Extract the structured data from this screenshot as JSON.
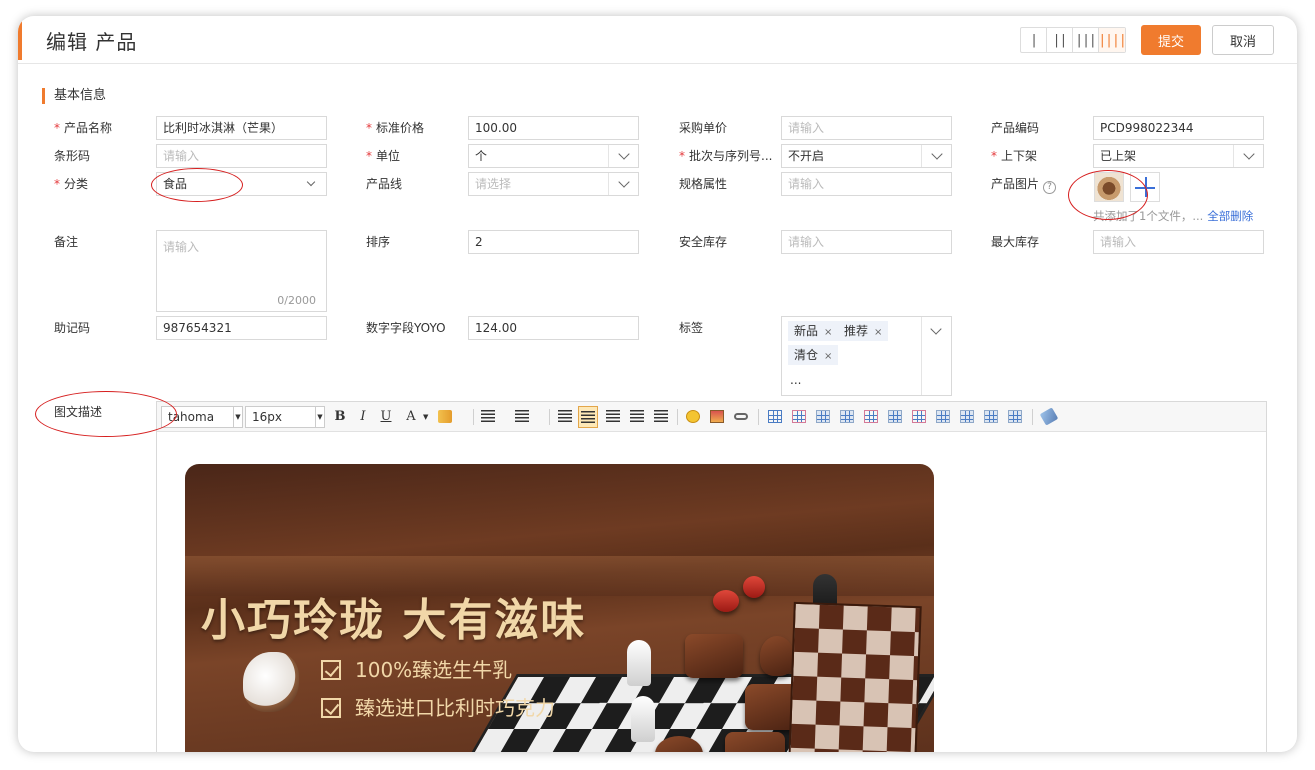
{
  "header": {
    "title": "编辑 产品",
    "layouts": [
      "|",
      "||",
      "|||",
      "||||"
    ],
    "submit_label": "提交",
    "cancel_label": "取消"
  },
  "section": {
    "title": "基本信息"
  },
  "fields": {
    "product_name": {
      "label": "产品名称",
      "value": "比利时冰淇淋（芒果）"
    },
    "std_price": {
      "label": "标准价格",
      "value": "100.00"
    },
    "purchase_price": {
      "label": "采购单价",
      "placeholder": "请输入"
    },
    "product_code": {
      "label": "产品编码",
      "value": "PCD998022344"
    },
    "barcode": {
      "label": "条形码",
      "placeholder": "请输入"
    },
    "unit": {
      "label": "单位",
      "value": "个"
    },
    "batch": {
      "label": "批次与序列号...",
      "value": "不开启"
    },
    "shelf": {
      "label": "上下架",
      "value": "已上架"
    },
    "category": {
      "label": "分类",
      "value": "食品"
    },
    "product_line": {
      "label": "产品线",
      "placeholder": "请选择"
    },
    "spec": {
      "label": "规格属性",
      "placeholder": "请输入"
    },
    "image": {
      "label": "产品图片",
      "help": "?",
      "note": "共添加了1个文件，...",
      "delete_all": "全部删除"
    },
    "remark": {
      "label": "备注",
      "placeholder": "请输入",
      "counter": "0/2000"
    },
    "sort": {
      "label": "排序",
      "value": "2"
    },
    "safety_stock": {
      "label": "安全库存",
      "placeholder": "请输入"
    },
    "max_stock": {
      "label": "最大库存",
      "placeholder": "请输入"
    },
    "mnemonic": {
      "label": "助记码",
      "value": "987654321"
    },
    "number_field": {
      "label": "数字字段YOYO",
      "value": "124.00"
    },
    "tags": {
      "label": "标签",
      "items": [
        "新品",
        "推荐",
        "清仓"
      ],
      "remove": "×",
      "more": "..."
    },
    "description": {
      "label": "图文描述"
    }
  },
  "required_mark": "*",
  "editor": {
    "font": "tahoma",
    "size": "16px",
    "bold": "B",
    "italic": "I",
    "underline": "U",
    "font_color": "A"
  },
  "banner": {
    "headline": "小巧玲珑 大有滋味",
    "line1": "100%臻选生牛乳",
    "line2": "臻选进口比利时巧克力"
  },
  "colors": {
    "accent": "#f07b2e",
    "link": "#3a6fd8",
    "annotation": "#d61f1f"
  }
}
